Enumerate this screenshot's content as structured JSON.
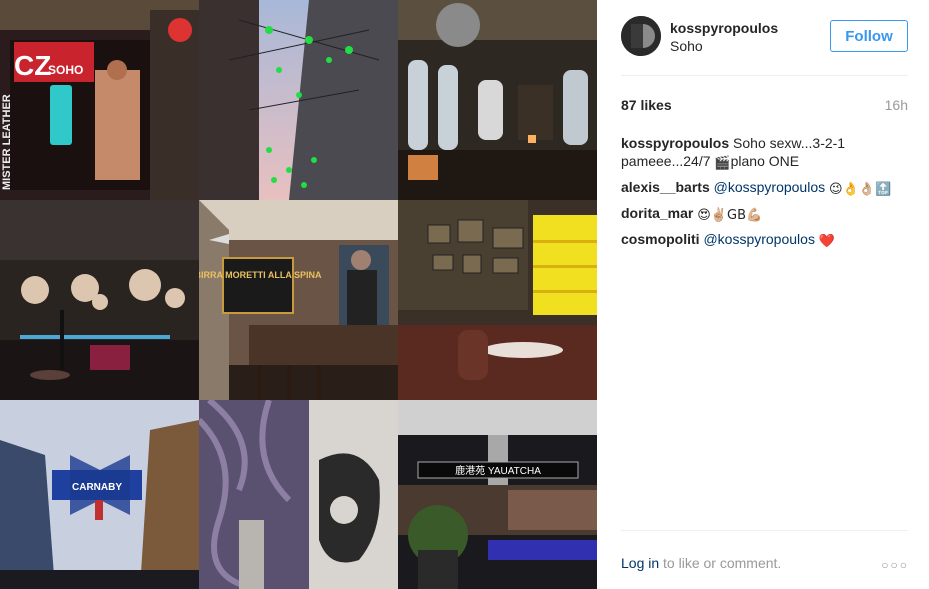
{
  "post": {
    "username": "kosspyropoulos",
    "location": "Soho",
    "follow_label": "Follow",
    "likes": "87 likes",
    "time_ago": "16h"
  },
  "photos": {
    "tile1_sign_left": "CZ",
    "tile1_sign_right": "SOHO",
    "tile1_side_text": "MISTER LEATHER",
    "tile5_sign": "BIRRA MORETTI ALLA SPINA",
    "tile7_sign": "CARNABY",
    "tile9_sign": "鹿港苑 YAUATCHA"
  },
  "comments": [
    {
      "user": "kosspyropoulos",
      "parts": [
        {
          "type": "text",
          "value": "Soho sexw...3-2-1 pameee...24/7 "
        },
        {
          "type": "emoji",
          "value": "🎬"
        },
        {
          "type": "text",
          "value": "plano ONE"
        }
      ]
    },
    {
      "user": "alexis__barts",
      "parts": [
        {
          "type": "mention",
          "value": "@kosspyropoulos"
        },
        {
          "type": "text",
          "value": " "
        },
        {
          "type": "emoji",
          "value": "😉👌👌🏼"
        },
        {
          "type": "emoji",
          "value": "🔝"
        }
      ]
    },
    {
      "user": "dorita_mar",
      "parts": [
        {
          "type": "emoji",
          "value": "😍✌🏼GB💪🏼"
        }
      ]
    },
    {
      "user": "cosmopoliti",
      "parts": [
        {
          "type": "mention",
          "value": "@kosspyropoulos"
        },
        {
          "type": "text",
          "value": " "
        },
        {
          "type": "emoji",
          "value": "❤️"
        }
      ]
    }
  ],
  "footer": {
    "login_link": "Log in",
    "login_rest": " to like or comment.",
    "more_label": "○○○"
  },
  "colors": {
    "link_blue": "#3897f0",
    "mention_blue": "#003569",
    "muted": "#999999"
  }
}
